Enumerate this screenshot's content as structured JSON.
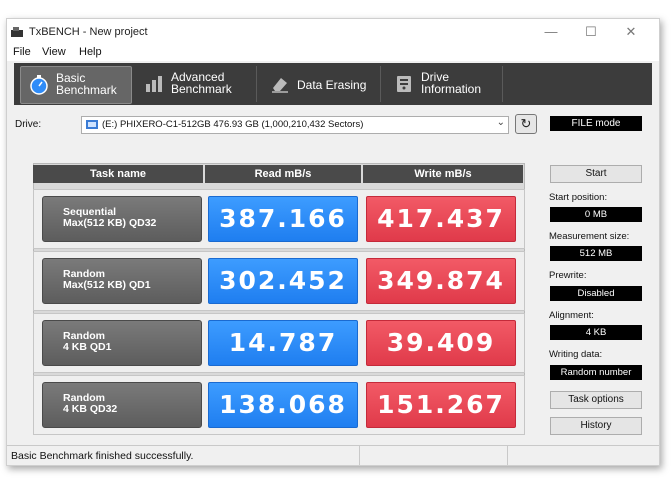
{
  "window": {
    "title": "TxBENCH - New project",
    "controls": {
      "minimize": "—",
      "maximize": "☐",
      "close": "✕"
    }
  },
  "menu": [
    "File",
    "View",
    "Help"
  ],
  "toolbar": {
    "tabs": [
      {
        "label": "Basic\nBenchmark",
        "icon": "stopwatch-icon",
        "active": true
      },
      {
        "label": "Advanced\nBenchmark",
        "icon": "bar-chart-icon",
        "active": false
      },
      {
        "label": "Data Erasing",
        "icon": "eraser-icon",
        "active": false
      },
      {
        "label": "Drive\nInformation",
        "icon": "drive-info-icon",
        "active": false
      }
    ]
  },
  "drive": {
    "label": "Drive:",
    "selected": "(E:) PHIXERO-C1-512GB  476.93 GB (1,000,210,432 Sectors)",
    "mode": "FILE mode"
  },
  "table": {
    "headers": [
      "Task name",
      "Read mB/s",
      "Write mB/s"
    ],
    "rows": [
      {
        "task": "Sequential\nMax(512 KB) QD32",
        "read": "387.166",
        "write": "417.437"
      },
      {
        "task": "Random\nMax(512 KB) QD1",
        "read": "302.452",
        "write": "349.874"
      },
      {
        "task": "Random\n4 KB QD1",
        "read": "14.787",
        "write": "39.409"
      },
      {
        "task": "Random\n4 KB QD32",
        "read": "138.068",
        "write": "151.267"
      }
    ]
  },
  "sidebar": {
    "start": "Start",
    "start_position_label": "Start position:",
    "start_position": "0 MB",
    "measurement_size_label": "Measurement size:",
    "measurement_size": "512 MB",
    "prewrite_label": "Prewrite:",
    "prewrite": "Disabled",
    "alignment_label": "Alignment:",
    "alignment": "4 KB",
    "writing_data_label": "Writing data:",
    "writing_data": "Random number",
    "task_options": "Task options",
    "history": "History"
  },
  "status": "Basic Benchmark finished successfully.",
  "colors": {
    "read": "#2f8cf8",
    "write": "#e84a58",
    "toolbar": "#3c3c3c"
  }
}
